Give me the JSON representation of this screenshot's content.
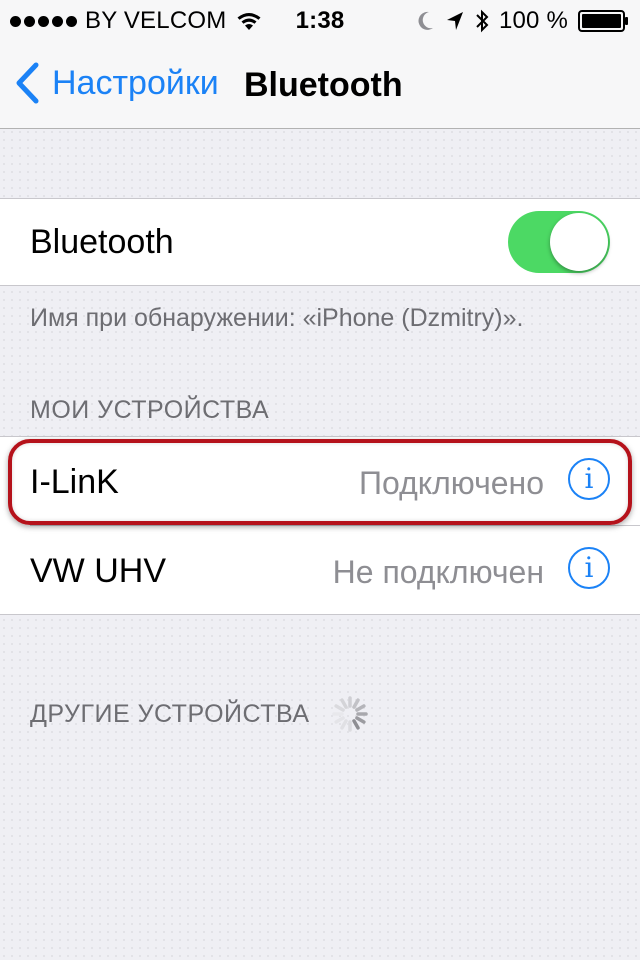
{
  "status_bar": {
    "carrier": "BY VELCOM",
    "time": "1:38",
    "battery": "100 %"
  },
  "nav": {
    "back_label": "Настройки",
    "title": "Bluetooth"
  },
  "bluetooth": {
    "label": "Bluetooth",
    "enabled": true,
    "discovery_note": "Имя при обнаружении: «iPhone (Dzmitry)»."
  },
  "sections": {
    "my_devices": "МОИ УСТРОЙСТВА",
    "other_devices": "ДРУГИЕ УСТРОЙСТВА"
  },
  "devices": [
    {
      "name": "I-LinK",
      "status": "Подключено"
    },
    {
      "name": "VW UHV",
      "status": "Не подключен"
    }
  ],
  "colors": {
    "accent": "#1b82f6",
    "toggle_on": "#4cd964",
    "highlight": "#b5121b"
  }
}
